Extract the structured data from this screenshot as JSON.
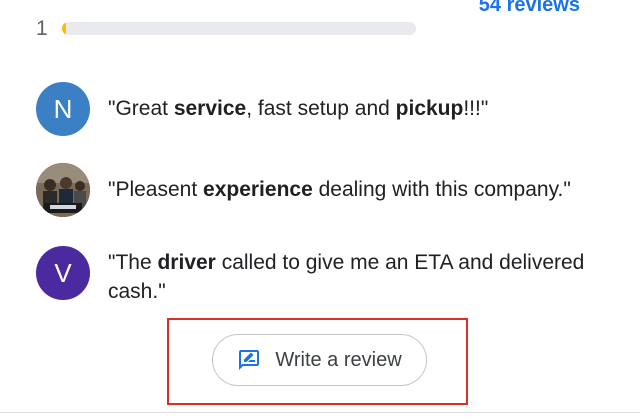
{
  "summary": {
    "reviews_link": "54 reviews",
    "rating_row": {
      "label": "1",
      "fill_fraction": 0.01,
      "fill_color": "#fbbc04"
    }
  },
  "reviews": [
    {
      "avatar": {
        "type": "letter",
        "letter": "N",
        "color": "#3b7fc4"
      },
      "text_parts": [
        {
          "t": "\"Great ",
          "b": false
        },
        {
          "t": "service",
          "b": true
        },
        {
          "t": ", fast setup and ",
          "b": false
        },
        {
          "t": "pickup",
          "b": true
        },
        {
          "t": "!!!\"",
          "b": false
        }
      ]
    },
    {
      "avatar": {
        "type": "photo",
        "icon": "user-photo-icon"
      },
      "text_parts": [
        {
          "t": "\"Pleasent ",
          "b": false
        },
        {
          "t": "experience",
          "b": true
        },
        {
          "t": " dealing with this company.\"",
          "b": false
        }
      ]
    },
    {
      "avatar": {
        "type": "letter",
        "letter": "V",
        "color": "#4b2aa0"
      },
      "text_parts": [
        {
          "t": "\"The ",
          "b": false
        },
        {
          "t": "driver",
          "b": true
        },
        {
          "t": " called to give me an ETA and delivered cash.\"",
          "b": false
        }
      ]
    }
  ],
  "write_review": {
    "label": "Write a review",
    "icon": "rate-review-icon",
    "icon_color": "#1a73e8",
    "highlight_color": "#d93025"
  }
}
